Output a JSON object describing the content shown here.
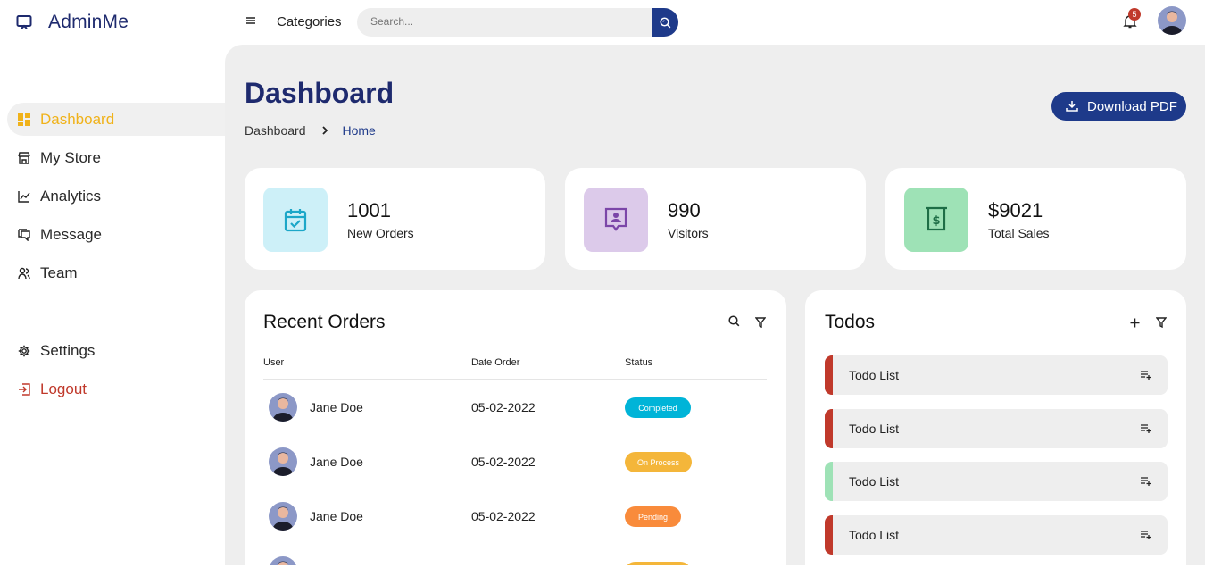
{
  "brand": {
    "name": "AdminMe"
  },
  "sidebar": {
    "items": [
      {
        "label": "Dashboard",
        "icon": "dashboard-icon",
        "active": true
      },
      {
        "label": "My Store",
        "icon": "store-icon"
      },
      {
        "label": "Analytics",
        "icon": "analytics-icon"
      },
      {
        "label": "Message",
        "icon": "message-icon"
      },
      {
        "label": "Team",
        "icon": "team-icon"
      }
    ],
    "bottom": [
      {
        "label": "Settings",
        "icon": "gear-icon"
      },
      {
        "label": "Logout",
        "icon": "logout-icon"
      }
    ]
  },
  "topbar": {
    "categories": "Categories",
    "search_placeholder": "Search...",
    "notification_count": "5"
  },
  "page": {
    "title": "Dashboard",
    "breadcrumb": [
      "Dashboard",
      "Home"
    ],
    "download_label": "Download PDF"
  },
  "stats": [
    {
      "value": "1001",
      "label": "New Orders",
      "color": "#cdf0f8",
      "icon": "calendar-check-icon"
    },
    {
      "value": "990",
      "label": "Visitors",
      "color": "#dccaea",
      "icon": "user-badge-icon"
    },
    {
      "value": "$9021",
      "label": "Total Sales",
      "color": "#9ee2b6",
      "icon": "dollar-icon"
    }
  ],
  "orders": {
    "title": "Recent Orders",
    "columns": [
      "User",
      "Date Order",
      "Status"
    ],
    "rows": [
      {
        "user": "Jane Doe",
        "date": "05-02-2022",
        "status": "Completed",
        "color": "#00b4d8"
      },
      {
        "user": "Jane Doe",
        "date": "05-02-2022",
        "status": "On Process",
        "color": "#f4b63a"
      },
      {
        "user": "Jane Doe",
        "date": "05-02-2022",
        "status": "Pending",
        "color": "#f98b3b"
      }
    ]
  },
  "todos": {
    "title": "Todos",
    "items": [
      {
        "label": "Todo List",
        "color": "#c0392b"
      },
      {
        "label": "Todo List",
        "color": "#c0392b"
      },
      {
        "label": "Todo List",
        "color": "#9ee2b6"
      },
      {
        "label": "Todo List",
        "color": "#c0392b"
      }
    ]
  }
}
